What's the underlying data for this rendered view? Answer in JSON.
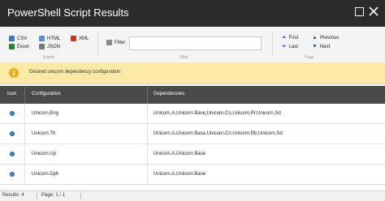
{
  "window": {
    "title": "PowerShell Script Results"
  },
  "ribbon": {
    "export": {
      "group_label": "Export",
      "csv_label": "CSV",
      "excel_label": "Excel",
      "html_label": "HTML",
      "json_label": "JSON",
      "xml_label": "XML"
    },
    "filter": {
      "group_label": "Filter",
      "filter_label": "Filter",
      "value": ""
    },
    "page": {
      "group_label": "Page",
      "first_label": "First",
      "previous_label": "Previous",
      "last_label": "Last",
      "next_label": "Next"
    }
  },
  "banner": {
    "text": "Desired unicorn dependency configuration"
  },
  "grid": {
    "columns": [
      "Icon",
      "Configuration",
      "Dependencies"
    ],
    "rows": [
      {
        "configuration": "Unicorn.Eng",
        "dependencies": "Unicorn.A,Unicorn.Base,Unicorn.Cn,Unicorn.Pr,Unicorn.Sd"
      },
      {
        "configuration": "Unicorn.Th",
        "dependencies": "Unicorn.A,Unicorn.Base,Unicorn.Cn,Unicorn.Rb,Unicorn.Sd"
      },
      {
        "configuration": "Unicorn.Up",
        "dependencies": "Unicorn.A,Unicorn.Base"
      },
      {
        "configuration": "Unicorn.Dph",
        "dependencies": "Unicorn.A,Unicorn.Base"
      }
    ]
  },
  "status": {
    "results": "Results: 4",
    "page": "Page: 1 / 1"
  },
  "colors": {
    "titlebar": "#2b2b2b",
    "banner": "#fbe9a6",
    "grid_header": "#4a4a4a",
    "accent": "#2f5fb4"
  }
}
